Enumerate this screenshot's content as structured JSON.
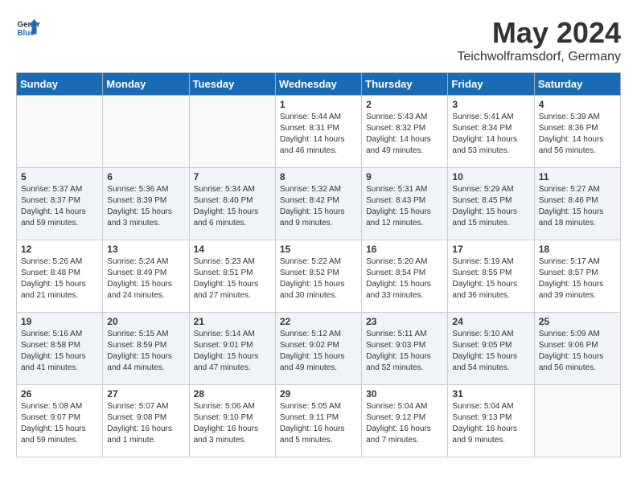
{
  "header": {
    "logo_general": "General",
    "logo_blue": "Blue",
    "month_year": "May 2024",
    "location": "Teichwolframsdorf, Germany"
  },
  "weekdays": [
    "Sunday",
    "Monday",
    "Tuesday",
    "Wednesday",
    "Thursday",
    "Friday",
    "Saturday"
  ],
  "weeks": [
    [
      {
        "day": "",
        "sunrise": "",
        "sunset": "",
        "daylight": ""
      },
      {
        "day": "",
        "sunrise": "",
        "sunset": "",
        "daylight": ""
      },
      {
        "day": "",
        "sunrise": "",
        "sunset": "",
        "daylight": ""
      },
      {
        "day": "1",
        "sunrise": "Sunrise: 5:44 AM",
        "sunset": "Sunset: 8:31 PM",
        "daylight": "Daylight: 14 hours and 46 minutes."
      },
      {
        "day": "2",
        "sunrise": "Sunrise: 5:43 AM",
        "sunset": "Sunset: 8:32 PM",
        "daylight": "Daylight: 14 hours and 49 minutes."
      },
      {
        "day": "3",
        "sunrise": "Sunrise: 5:41 AM",
        "sunset": "Sunset: 8:34 PM",
        "daylight": "Daylight: 14 hours and 53 minutes."
      },
      {
        "day": "4",
        "sunrise": "Sunrise: 5:39 AM",
        "sunset": "Sunset: 8:36 PM",
        "daylight": "Daylight: 14 hours and 56 minutes."
      }
    ],
    [
      {
        "day": "5",
        "sunrise": "Sunrise: 5:37 AM",
        "sunset": "Sunset: 8:37 PM",
        "daylight": "Daylight: 14 hours and 59 minutes."
      },
      {
        "day": "6",
        "sunrise": "Sunrise: 5:36 AM",
        "sunset": "Sunset: 8:39 PM",
        "daylight": "Daylight: 15 hours and 3 minutes."
      },
      {
        "day": "7",
        "sunrise": "Sunrise: 5:34 AM",
        "sunset": "Sunset: 8:40 PM",
        "daylight": "Daylight: 15 hours and 6 minutes."
      },
      {
        "day": "8",
        "sunrise": "Sunrise: 5:32 AM",
        "sunset": "Sunset: 8:42 PM",
        "daylight": "Daylight: 15 hours and 9 minutes."
      },
      {
        "day": "9",
        "sunrise": "Sunrise: 5:31 AM",
        "sunset": "Sunset: 8:43 PM",
        "daylight": "Daylight: 15 hours and 12 minutes."
      },
      {
        "day": "10",
        "sunrise": "Sunrise: 5:29 AM",
        "sunset": "Sunset: 8:45 PM",
        "daylight": "Daylight: 15 hours and 15 minutes."
      },
      {
        "day": "11",
        "sunrise": "Sunrise: 5:27 AM",
        "sunset": "Sunset: 8:46 PM",
        "daylight": "Daylight: 15 hours and 18 minutes."
      }
    ],
    [
      {
        "day": "12",
        "sunrise": "Sunrise: 5:26 AM",
        "sunset": "Sunset: 8:48 PM",
        "daylight": "Daylight: 15 hours and 21 minutes."
      },
      {
        "day": "13",
        "sunrise": "Sunrise: 5:24 AM",
        "sunset": "Sunset: 8:49 PM",
        "daylight": "Daylight: 15 hours and 24 minutes."
      },
      {
        "day": "14",
        "sunrise": "Sunrise: 5:23 AM",
        "sunset": "Sunset: 8:51 PM",
        "daylight": "Daylight: 15 hours and 27 minutes."
      },
      {
        "day": "15",
        "sunrise": "Sunrise: 5:22 AM",
        "sunset": "Sunset: 8:52 PM",
        "daylight": "Daylight: 15 hours and 30 minutes."
      },
      {
        "day": "16",
        "sunrise": "Sunrise: 5:20 AM",
        "sunset": "Sunset: 8:54 PM",
        "daylight": "Daylight: 15 hours and 33 minutes."
      },
      {
        "day": "17",
        "sunrise": "Sunrise: 5:19 AM",
        "sunset": "Sunset: 8:55 PM",
        "daylight": "Daylight: 15 hours and 36 minutes."
      },
      {
        "day": "18",
        "sunrise": "Sunrise: 5:17 AM",
        "sunset": "Sunset: 8:57 PM",
        "daylight": "Daylight: 15 hours and 39 minutes."
      }
    ],
    [
      {
        "day": "19",
        "sunrise": "Sunrise: 5:16 AM",
        "sunset": "Sunset: 8:58 PM",
        "daylight": "Daylight: 15 hours and 41 minutes."
      },
      {
        "day": "20",
        "sunrise": "Sunrise: 5:15 AM",
        "sunset": "Sunset: 8:59 PM",
        "daylight": "Daylight: 15 hours and 44 minutes."
      },
      {
        "day": "21",
        "sunrise": "Sunrise: 5:14 AM",
        "sunset": "Sunset: 9:01 PM",
        "daylight": "Daylight: 15 hours and 47 minutes."
      },
      {
        "day": "22",
        "sunrise": "Sunrise: 5:12 AM",
        "sunset": "Sunset: 9:02 PM",
        "daylight": "Daylight: 15 hours and 49 minutes."
      },
      {
        "day": "23",
        "sunrise": "Sunrise: 5:11 AM",
        "sunset": "Sunset: 9:03 PM",
        "daylight": "Daylight: 15 hours and 52 minutes."
      },
      {
        "day": "24",
        "sunrise": "Sunrise: 5:10 AM",
        "sunset": "Sunset: 9:05 PM",
        "daylight": "Daylight: 15 hours and 54 minutes."
      },
      {
        "day": "25",
        "sunrise": "Sunrise: 5:09 AM",
        "sunset": "Sunset: 9:06 PM",
        "daylight": "Daylight: 15 hours and 56 minutes."
      }
    ],
    [
      {
        "day": "26",
        "sunrise": "Sunrise: 5:08 AM",
        "sunset": "Sunset: 9:07 PM",
        "daylight": "Daylight: 15 hours and 59 minutes."
      },
      {
        "day": "27",
        "sunrise": "Sunrise: 5:07 AM",
        "sunset": "Sunset: 9:08 PM",
        "daylight": "Daylight: 16 hours and 1 minute."
      },
      {
        "day": "28",
        "sunrise": "Sunrise: 5:06 AM",
        "sunset": "Sunset: 9:10 PM",
        "daylight": "Daylight: 16 hours and 3 minutes."
      },
      {
        "day": "29",
        "sunrise": "Sunrise: 5:05 AM",
        "sunset": "Sunset: 9:11 PM",
        "daylight": "Daylight: 16 hours and 5 minutes."
      },
      {
        "day": "30",
        "sunrise": "Sunrise: 5:04 AM",
        "sunset": "Sunset: 9:12 PM",
        "daylight": "Daylight: 16 hours and 7 minutes."
      },
      {
        "day": "31",
        "sunrise": "Sunrise: 5:04 AM",
        "sunset": "Sunset: 9:13 PM",
        "daylight": "Daylight: 16 hours and 9 minutes."
      },
      {
        "day": "",
        "sunrise": "",
        "sunset": "",
        "daylight": ""
      }
    ]
  ]
}
